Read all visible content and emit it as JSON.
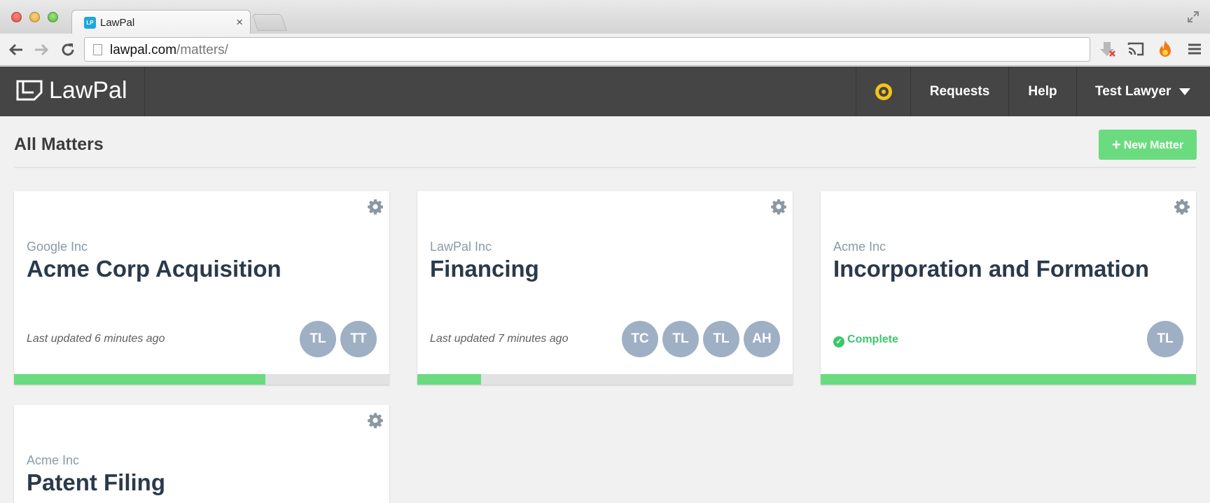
{
  "browser": {
    "tab_title": "LawPal",
    "favicon_text": "LP",
    "url_host": "lawpal.com",
    "url_path": "/matters/"
  },
  "header": {
    "logo_text": "LawPal",
    "nav": {
      "requests": "Requests",
      "help": "Help",
      "user": "Test Lawyer"
    }
  },
  "page": {
    "title": "All Matters",
    "new_matter_label": "New Matter"
  },
  "matters": [
    {
      "client": "Google Inc",
      "name": "Acme Corp Acquisition",
      "status": "Last updated 6 minutes ago",
      "participants": [
        "TL",
        "TT"
      ],
      "progress": 0.67
    },
    {
      "client": "LawPal Inc",
      "name": "Financing",
      "status": "Last updated 7 minutes ago",
      "participants": [
        "TC",
        "TL",
        "TL",
        "AH"
      ],
      "progress": 0.17
    },
    {
      "client": "Acme Inc",
      "name": "Incorporation and Formation",
      "status": "Complete",
      "participants": [
        "TL"
      ],
      "progress": 1.0
    },
    {
      "client": "Acme Inc",
      "name": "Patent Filing"
    }
  ],
  "colors": {
    "header_bg": "#454545",
    "accent_green": "#6bdb80",
    "avatar_bg": "#9fb0c5",
    "title_text": "#2a3a4b"
  }
}
